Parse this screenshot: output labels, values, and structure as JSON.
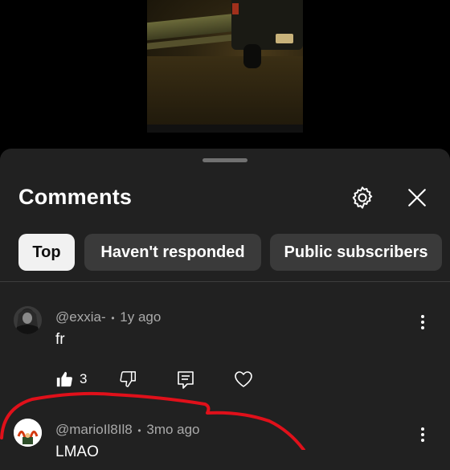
{
  "video": {
    "icon": "video-frame"
  },
  "sheet": {
    "title": "Comments",
    "icons": {
      "settings": "gear-icon",
      "close": "close-icon"
    },
    "chips": [
      {
        "label": "Top",
        "selected": true
      },
      {
        "label": "Haven't responded",
        "selected": false
      },
      {
        "label": "Public subscribers",
        "selected": false
      }
    ]
  },
  "comments": [
    {
      "author": "@exxia-",
      "separator": "•",
      "time": "1y ago",
      "text": "fr",
      "likes": "3"
    },
    {
      "author": "@marioIl8Il8",
      "separator": "•",
      "time": "3mo ago",
      "text": "LMAO"
    }
  ],
  "colors": {
    "sheet_bg": "#212121",
    "chip_bg": "#3a3a3a",
    "chip_active_bg": "#f1f1f1",
    "annotation_red": "#e0101a"
  }
}
